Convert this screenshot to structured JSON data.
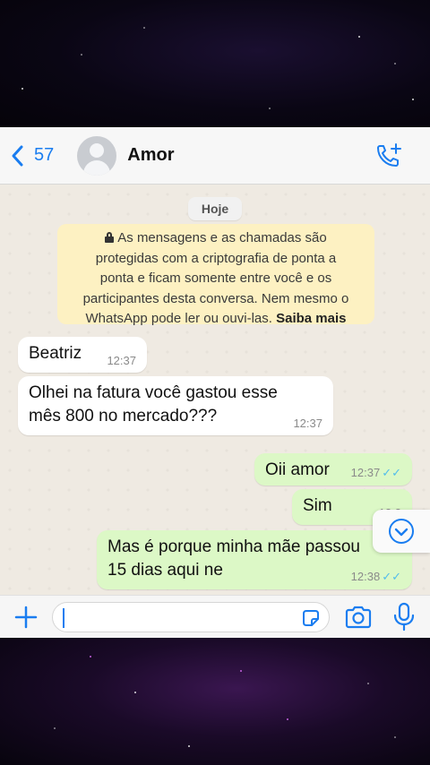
{
  "header": {
    "back_count": "57",
    "contact_name": "Amor"
  },
  "chat": {
    "date_label": "Hoje",
    "encryption_notice": {
      "lines": [
        "As mensagens e as chamadas são",
        "protegidas com a criptografia de ponta a",
        "ponta e ficam somente entre você e os",
        "participantes desta conversa. Nem mesmo o",
        "WhatsApp pode ler ou ouvi-las."
      ],
      "link": "Saiba mais"
    },
    "messages": [
      {
        "direction": "incoming",
        "text": "Beatriz",
        "time": "12:37"
      },
      {
        "direction": "incoming",
        "text_lines": [
          "Olhei na fatura você gastou esse",
          "mês 800 no mercado???"
        ],
        "time": "12:37"
      },
      {
        "direction": "outgoing",
        "text": "Oii amor",
        "time": "12:37",
        "ticks": "✓✓"
      },
      {
        "direction": "outgoing",
        "text": "Sim",
        "time": "12:3"
      },
      {
        "direction": "outgoing",
        "text_lines": [
          "Mas é porque minha mãe passou",
          "15 dias aqui ne"
        ],
        "time": "12:38",
        "ticks": "✓✓"
      }
    ]
  },
  "input": {
    "placeholder": ""
  },
  "colors": {
    "accent": "#1a7df0",
    "outgoing_bubble": "#dcf8c6",
    "incoming_bubble": "#ffffff",
    "notice_bg": "#fdf1c2",
    "read_ticks": "#53bdeb"
  },
  "icons": [
    "back-chevron-icon",
    "add-call-icon",
    "lock-icon",
    "scroll-down-icon",
    "plus-icon",
    "sticker-icon",
    "camera-icon",
    "mic-icon"
  ]
}
